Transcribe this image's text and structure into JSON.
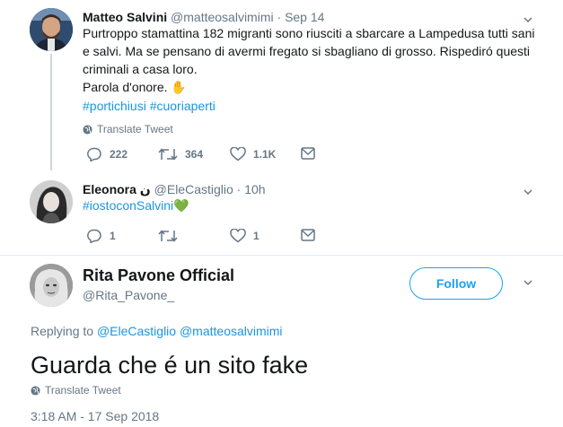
{
  "tweet1": {
    "name": "Matteo Salvini",
    "handle": "@matteosalvimimi",
    "dot": "·",
    "time": "Sep 14",
    "lines": [
      "Purtroppo stamattina 182 migranti sono riusciti a sbarcare a Lampedusa tutti sani",
      "e salvi. Ma se pensano di avermi fregato si sbagliano di grosso. Rispediró questi",
      "criminali a casa loro.",
      "Parola d'onore."
    ],
    "emoji": "✋",
    "hashtags": "#portichiusi #cuoriaperti",
    "translate": "Translate Tweet",
    "replies": "222",
    "retweets": "364",
    "likes": "1.1K"
  },
  "tweet2": {
    "name": "Eleonora",
    "name_suffix": "ن",
    "handle": "@EleCastiglio",
    "dot": "·",
    "time": "10h",
    "hashtag": "#iostoconSalvini",
    "emoji": "💚",
    "replies": "1",
    "retweets": "",
    "likes": "1"
  },
  "tweet3": {
    "name": "Rita Pavone Official",
    "handle": "@Rita_Pavone_",
    "follow": "Follow",
    "replying_prefix": "Replying to",
    "replying_to": "@EleCastiglio @matteosalvimimi",
    "text": "Guarda che é un sito fake",
    "translate": "Translate Tweet",
    "timestamp": "3:18 AM - 17 Sep 2018"
  },
  "colors": {
    "link": "#1b95e0",
    "follow": "#1da1f2",
    "muted": "#657786",
    "divider": "#e6ecf0",
    "heart_green": "#77b255"
  },
  "icons": [
    "globe-icon",
    "reply-icon",
    "retweet-icon",
    "like-icon",
    "dm-icon",
    "chevron-down-icon"
  ]
}
